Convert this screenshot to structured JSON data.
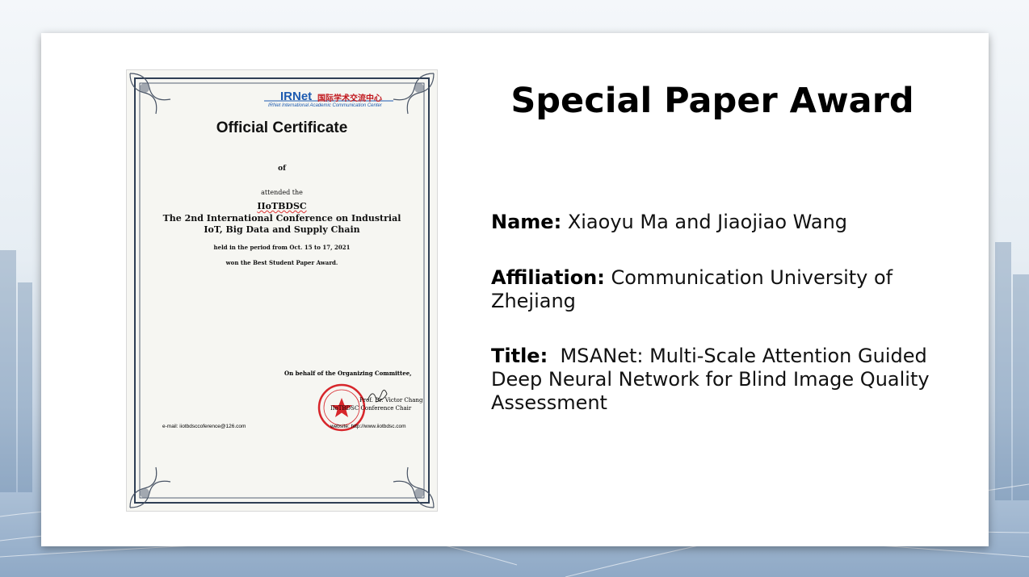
{
  "award_title": "Special Paper Award",
  "name_label": "Name:",
  "name_value": "Xiaoyu Ma and Jiaojiao Wang",
  "affiliation_label": "Affiliation:",
  "affiliation_value": "Communication University of Zhejiang",
  "title_label": "Title:",
  "title_value": "MSANet: Multi-Scale Attention Guided Deep Neural Network for Blind Image Quality Assessment",
  "certificate": {
    "logo": "IRNet",
    "logo_cn": "国际学术交流中心",
    "org": "IRNet International Academic Communication Center",
    "heading": "Official Certificate",
    "of": "of",
    "attended": "attended the",
    "abbr": "IIoTBDSC",
    "conference_line1": "The 2nd International Conference on Industrial",
    "conference_line2": "IoT, Big Data and Supply Chain",
    "held": "held in the period from Oct. 15 to 17, 2021",
    "won": "won the Best Student Paper Award.",
    "behalf": "On behalf of the Organizing Committee,",
    "signer": "Prof. Dr. Victor Chang",
    "signer_role": "IIoTBDSC Conference Chair",
    "email": "e-mail: iiotbdsccoference@126.com",
    "website": "website: http://www.iiotbdsc.com"
  },
  "colors": {
    "seal": "#d7262b",
    "logo_blue": "#1d5bb0",
    "frame": "#2f3f55"
  }
}
